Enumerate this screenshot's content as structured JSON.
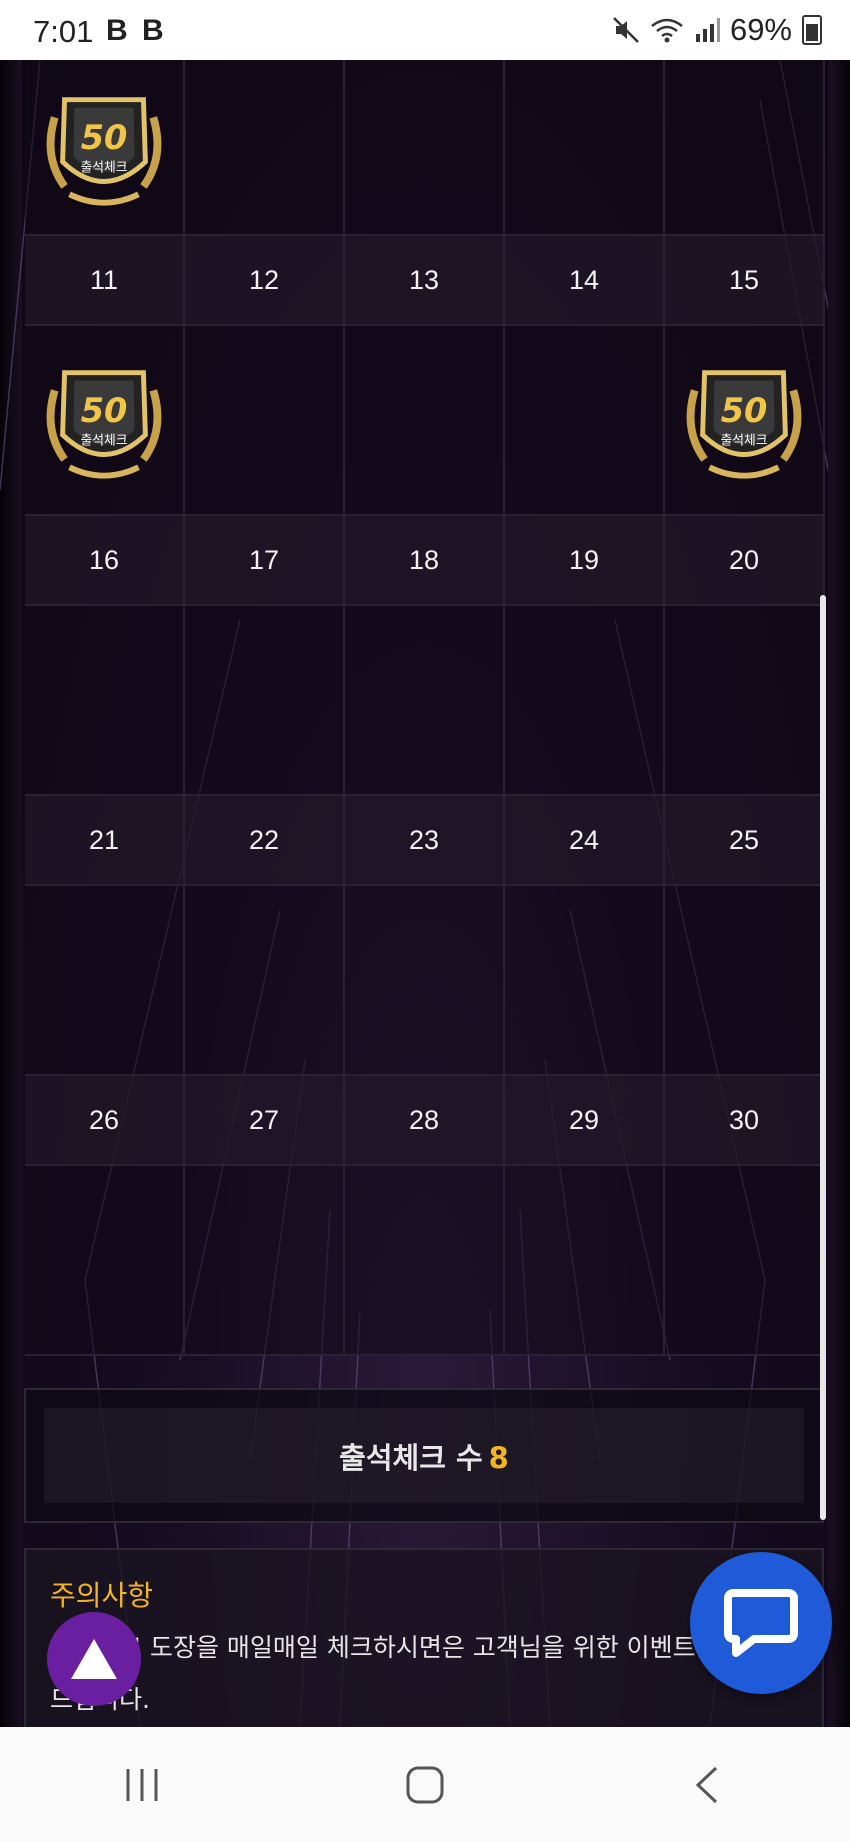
{
  "status_bar": {
    "time": "7:01",
    "app_icons": [
      "B",
      "B"
    ],
    "battery": "69%",
    "icons": [
      "mute-icon",
      "wifi-icon",
      "signal-icon",
      "battery-icon"
    ]
  },
  "calendar": {
    "stamp_text": "50",
    "stamp_label": "출석체크",
    "rows": [
      {
        "days": [],
        "stamps": [
          true,
          false,
          false,
          false,
          false
        ]
      },
      {
        "days": [
          "11",
          "12",
          "13",
          "14",
          "15"
        ],
        "stamps": [
          true,
          false,
          false,
          false,
          true
        ]
      },
      {
        "days": [
          "16",
          "17",
          "18",
          "19",
          "20"
        ],
        "stamps": [
          false,
          false,
          false,
          false,
          false
        ]
      },
      {
        "days": [
          "21",
          "22",
          "23",
          "24",
          "25"
        ],
        "stamps": [
          false,
          false,
          false,
          false,
          false
        ]
      },
      {
        "days": [
          "26",
          "27",
          "28",
          "29",
          "30"
        ],
        "stamps": [
          false,
          false,
          false,
          false,
          false
        ]
      }
    ]
  },
  "attendance": {
    "label": "출석체크 수",
    "count": "8"
  },
  "notice": {
    "title": "주의사항",
    "line1": "출석체크 도장을 매일매일 체크하시면은 고객님을 위한 이벤트",
    "line2": "드립니다."
  },
  "colors": {
    "accent": "#f2b51f",
    "chat_button": "#1f5ad8",
    "top_button": "#6a1fa0"
  }
}
